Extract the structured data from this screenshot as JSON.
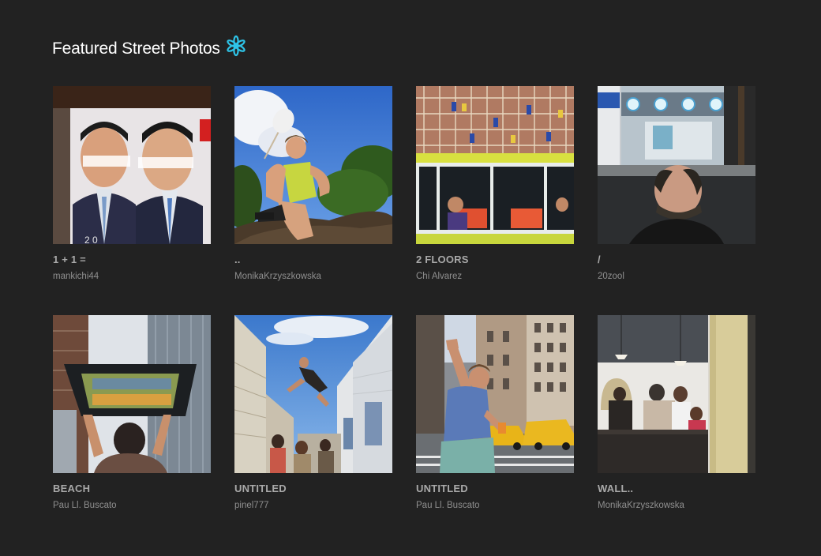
{
  "header": {
    "title": "Featured Street Photos",
    "icon": "asterisk-flower-icon",
    "icon_color": "#2ec4e8"
  },
  "colors": {
    "background": "#222222",
    "title": "#ffffff",
    "photo_title": "#a9a9a9",
    "author": "#8f8f8f"
  },
  "photos": [
    {
      "title": "1 + 1 =",
      "author": "mankichi44",
      "image": "poster-two-men-photo"
    },
    {
      "title": "..",
      "author": "MonikaKrzyszkowska",
      "image": "girl-on-rock-photo"
    },
    {
      "title": "2 FLOORS",
      "author": "Chi Alvarez",
      "image": "scaffolding-bus-photo"
    },
    {
      "title": "/",
      "author": "20zool",
      "image": "balding-man-street-photo"
    },
    {
      "title": "BEACH",
      "author": "Pau Ll. Buscato",
      "image": "man-holding-painting-photo"
    },
    {
      "title": "UNTITLED",
      "author": "pinel777",
      "image": "jumping-person-alley-photo"
    },
    {
      "title": "UNTITLED",
      "author": "Pau Ll. Buscato",
      "image": "man-stretching-taxi-photo"
    },
    {
      "title": "WALL..",
      "author": "MonikaKrzyszkowska",
      "image": "cafe-interior-photo"
    }
  ]
}
